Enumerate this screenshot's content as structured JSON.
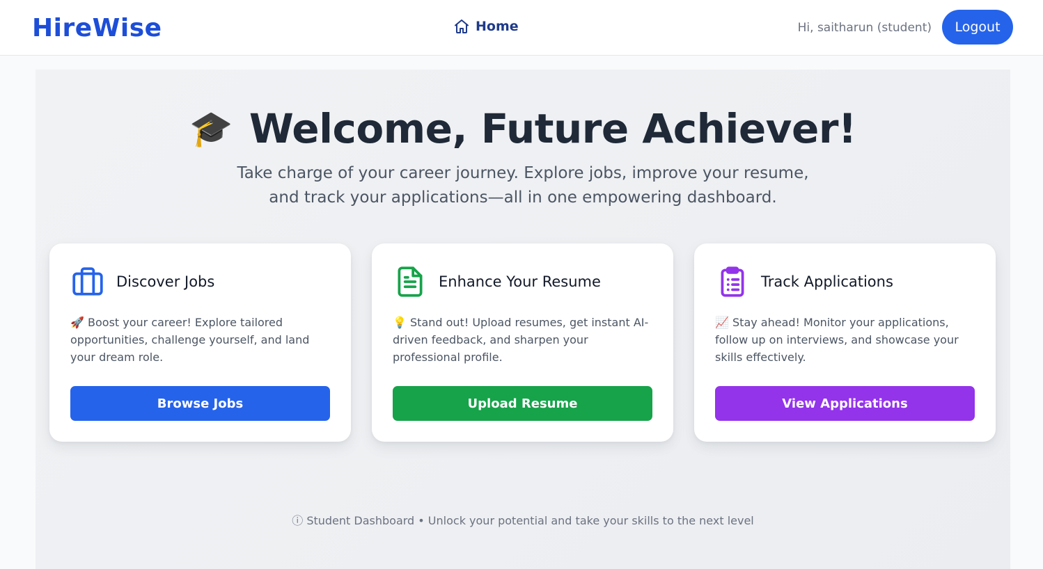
{
  "header": {
    "brand": "HireWise",
    "nav_home_label": "Home",
    "greeting": "Hi, saitharun (student)",
    "logout_label": "Logout"
  },
  "hero": {
    "emoji": "🎓",
    "title": "Welcome, Future Achiever!",
    "subtitle": "Take charge of your career journey. Explore jobs, improve your resume, and track your applications—all in one empowering dashboard."
  },
  "cards": [
    {
      "icon": "briefcase-icon",
      "title": "Discover Jobs",
      "description": "🚀 Boost your career! Explore tailored opportunities, challenge yourself, and land your dream role.",
      "button_label": "Browse Jobs",
      "color": "#2563eb"
    },
    {
      "icon": "document-icon",
      "title": "Enhance Your Resume",
      "description": "💡 Stand out! Upload resumes, get instant AI-driven feedback, and sharpen your professional profile.",
      "button_label": "Upload Resume",
      "color": "#16a34a"
    },
    {
      "icon": "clipboard-list-icon",
      "title": "Track Applications",
      "description": "📈 Stay ahead! Monitor your applications, follow up on interviews, and showcase your skills effectively.",
      "button_label": "View Applications",
      "color": "#9333ea"
    }
  ],
  "footer": {
    "note": "ⓘ Student Dashboard • Unlock your potential and take your skills to the next level"
  },
  "colors": {
    "brand": "#1d4ed8",
    "primary": "#2563eb",
    "success": "#16a34a",
    "purple": "#9333ea"
  }
}
